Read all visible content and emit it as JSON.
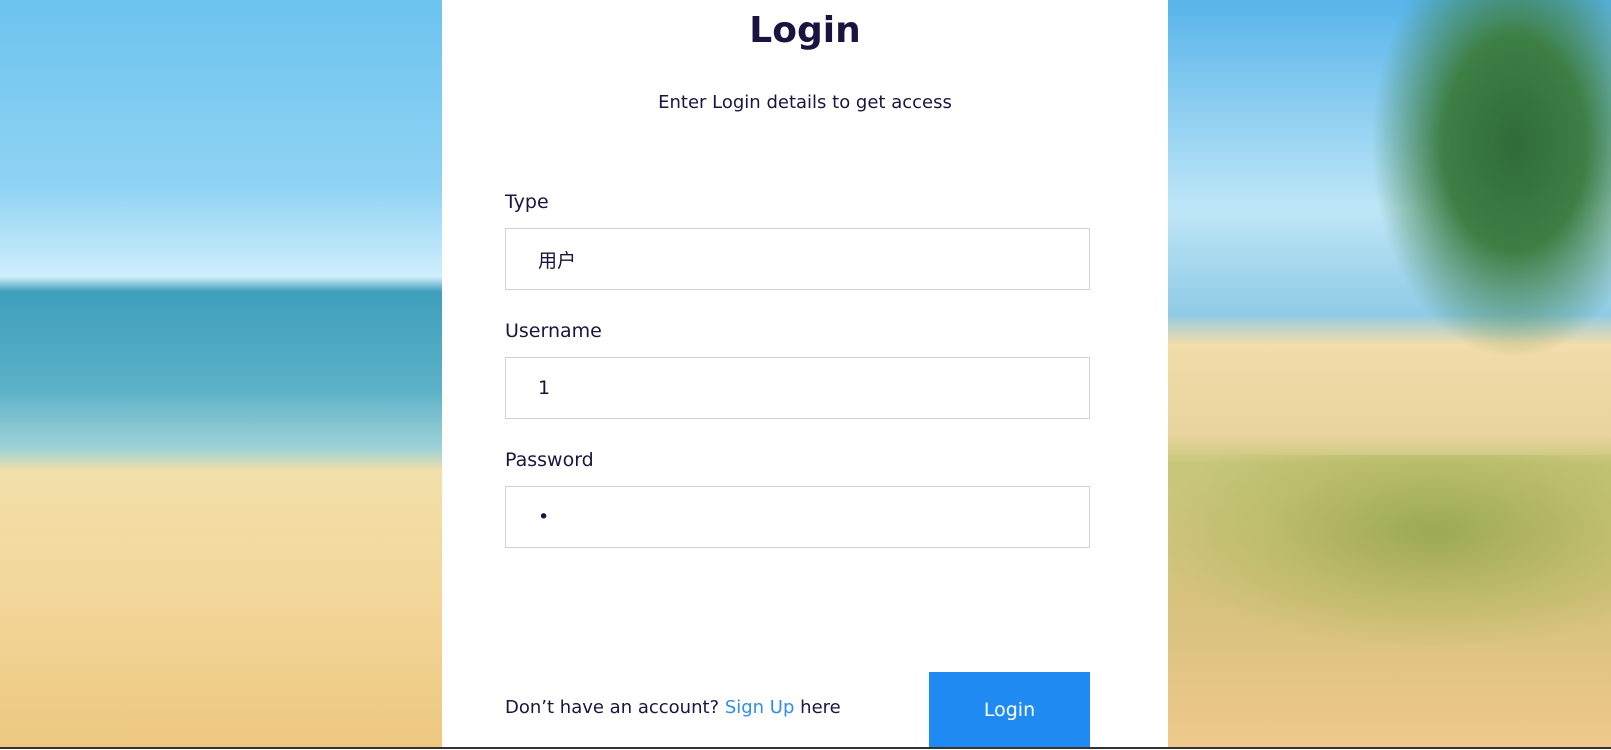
{
  "form": {
    "title": "Login",
    "subtitle": "Enter Login details to get access",
    "type_label": "Type",
    "type_value": "用户",
    "username_label": "Username",
    "username_value": "1",
    "password_label": "Password",
    "password_value": "•",
    "footer_prefix": "Don’t have an account?",
    "signup_link": "Sign Up",
    "footer_suffix": "here",
    "login_button": "Login"
  },
  "colors": {
    "accent": "#1f8bf2",
    "link": "#2f8fe8",
    "text": "#1b1440"
  }
}
